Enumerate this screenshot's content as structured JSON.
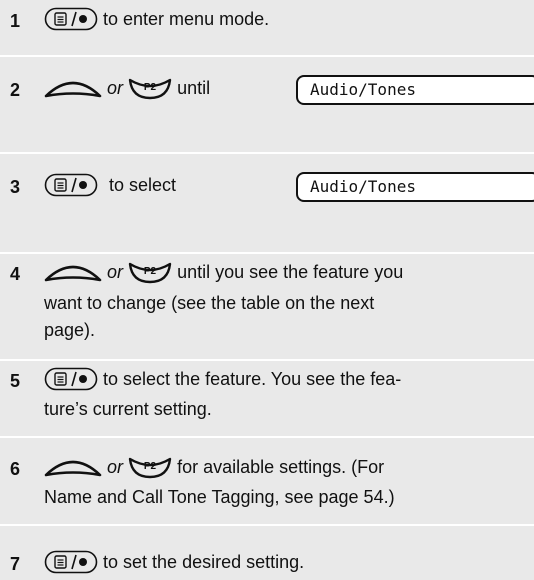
{
  "steps": [
    {
      "number": "1",
      "text": "to enter menu mode."
    },
    {
      "number": "2",
      "or": "or",
      "text": "until",
      "display": "Audio/Tones"
    },
    {
      "number": "3",
      "text": "to select",
      "display": "Audio/Tones"
    },
    {
      "number": "4",
      "or": "or",
      "line1": "until you see the feature you",
      "line2": "want to change (see the table on the next",
      "line3": "page)."
    },
    {
      "number": "5",
      "line1": "to select the feature. You see the fea-",
      "line2": "ture’s current setting."
    },
    {
      "number": "6",
      "or": "or",
      "line1": "for available settings. (For",
      "line2": "Name and Call Tone Tagging, see page 54.)"
    },
    {
      "number": "7",
      "text": "to set the desired setting."
    }
  ],
  "icons": {
    "menu_select": "menu-select-key-icon",
    "scroll_up": "scroll-up-key-icon",
    "p2": "p2-key-icon",
    "p2_label": "P2"
  }
}
